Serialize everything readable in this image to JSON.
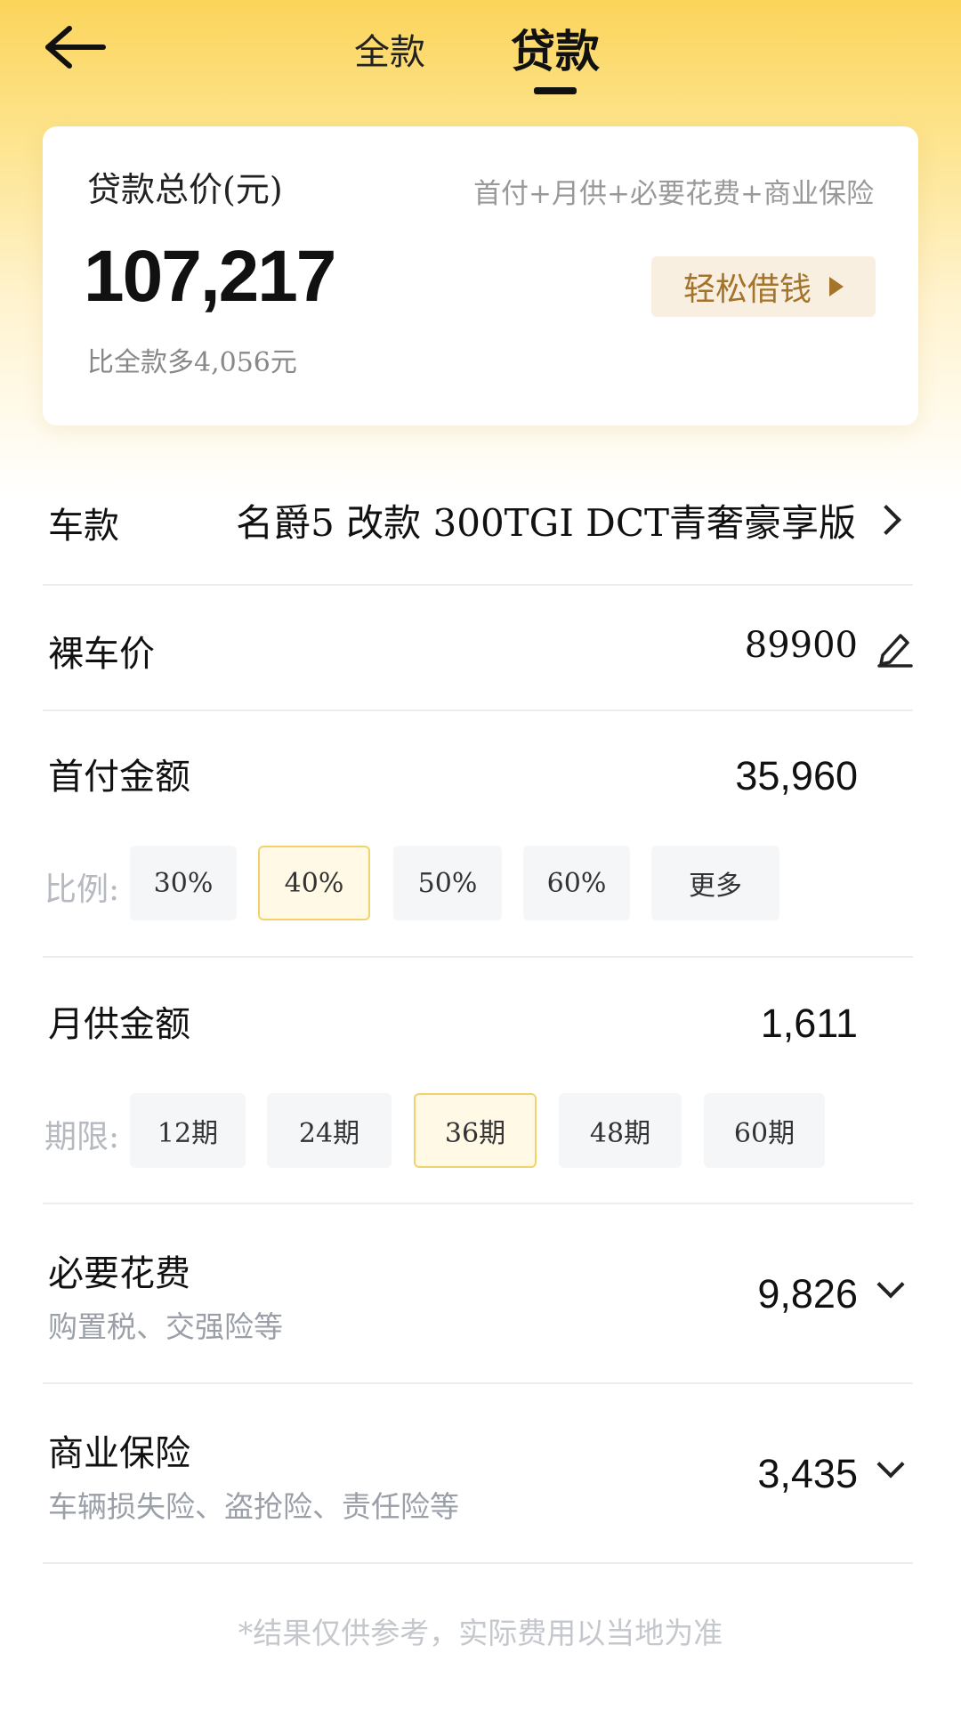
{
  "header": {
    "tab_full": "全款",
    "tab_loan": "贷款"
  },
  "summary": {
    "title": "贷款总价(元)",
    "formula": "首付+月供+必要花费+商业保险",
    "total": "107,217",
    "diff": "比全款多4,056元",
    "borrow_label": "轻松借钱"
  },
  "model": {
    "label": "车款",
    "value": "名爵5 改款 300TGI DCT青奢豪享版"
  },
  "bare_price": {
    "label": "裸车价",
    "value": "89900"
  },
  "down_payment": {
    "label": "首付金额",
    "value": "35,960",
    "ratio_label": "比例:",
    "options": [
      "30%",
      "40%",
      "50%",
      "60%",
      "更多"
    ],
    "selected": "40%"
  },
  "monthly": {
    "label": "月供金额",
    "value": "1,611",
    "term_label": "期限:",
    "options": [
      "12期",
      "24期",
      "36期",
      "48期",
      "60期"
    ],
    "selected": "36期"
  },
  "required_fees": {
    "label": "必要花费",
    "sub": "购置税、交强险等",
    "value": "9,826"
  },
  "commercial_insurance": {
    "label": "商业保险",
    "sub": "车辆损失险、盗抢险、责任险等",
    "value": "3,435"
  },
  "footer_note": "*结果仅供参考，实际费用以当地为准",
  "colors": {
    "header_yellow": "#fbd45a",
    "borrow_bg": "#f8efe0",
    "borrow_text": "#a3742a",
    "chip_active_border": "#f2d36b"
  }
}
